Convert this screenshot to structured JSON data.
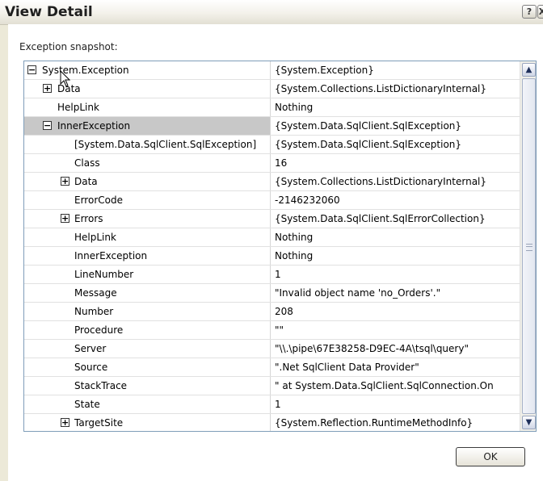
{
  "window": {
    "title": "View Detail",
    "help_glyph": "?",
    "close_glyph": "X"
  },
  "snapshot_label": "Exception snapshot:",
  "rows": [
    {
      "name": "System.Exception",
      "value": "{System.Exception}",
      "expander": "minus",
      "level": 0
    },
    {
      "name": "Data",
      "value": "{System.Collections.ListDictionaryInternal}",
      "expander": "plus",
      "level": 1
    },
    {
      "name": "HelpLink",
      "value": "Nothing",
      "expander": "",
      "level": 1
    },
    {
      "name": "InnerException",
      "value": "{System.Data.SqlClient.SqlException}",
      "expander": "minus",
      "level": 1,
      "selected": true
    },
    {
      "name": "[System.Data.SqlClient.SqlException]",
      "value": "{System.Data.SqlClient.SqlException}",
      "expander": "",
      "level": 2
    },
    {
      "name": "Class",
      "value": "16",
      "expander": "",
      "level": 2
    },
    {
      "name": "Data",
      "value": "{System.Collections.ListDictionaryInternal}",
      "expander": "plus",
      "level": 2
    },
    {
      "name": "ErrorCode",
      "value": "-2146232060",
      "expander": "",
      "level": 2
    },
    {
      "name": "Errors",
      "value": "{System.Data.SqlClient.SqlErrorCollection}",
      "expander": "plus",
      "level": 2
    },
    {
      "name": "HelpLink",
      "value": "Nothing",
      "expander": "",
      "level": 2
    },
    {
      "name": "InnerException",
      "value": "Nothing",
      "expander": "",
      "level": 2
    },
    {
      "name": "LineNumber",
      "value": "1",
      "expander": "",
      "level": 2
    },
    {
      "name": "Message",
      "value": "\"Invalid object name 'no_Orders'.\"",
      "expander": "",
      "level": 2
    },
    {
      "name": "Number",
      "value": "208",
      "expander": "",
      "level": 2
    },
    {
      "name": "Procedure",
      "value": "\"\"",
      "expander": "",
      "level": 2
    },
    {
      "name": "Server",
      "value": "\"\\\\.\\pipe\\67E38258-D9EC-4A\\tsql\\query\"",
      "expander": "",
      "level": 2
    },
    {
      "name": "Source",
      "value": "\".Net SqlClient Data Provider\"",
      "expander": "",
      "level": 2
    },
    {
      "name": "StackTrace",
      "value": "\"   at System.Data.SqlClient.SqlConnection.On",
      "expander": "",
      "level": 2
    },
    {
      "name": "State",
      "value": "1",
      "expander": "",
      "level": 2
    },
    {
      "name": "TargetSite",
      "value": "{System.Reflection.RuntimeMethodInfo}",
      "expander": "plus",
      "level": 2
    }
  ],
  "scrollbar": {
    "up_glyph": "▲",
    "down_glyph": "▼"
  },
  "ok_label": "OK"
}
